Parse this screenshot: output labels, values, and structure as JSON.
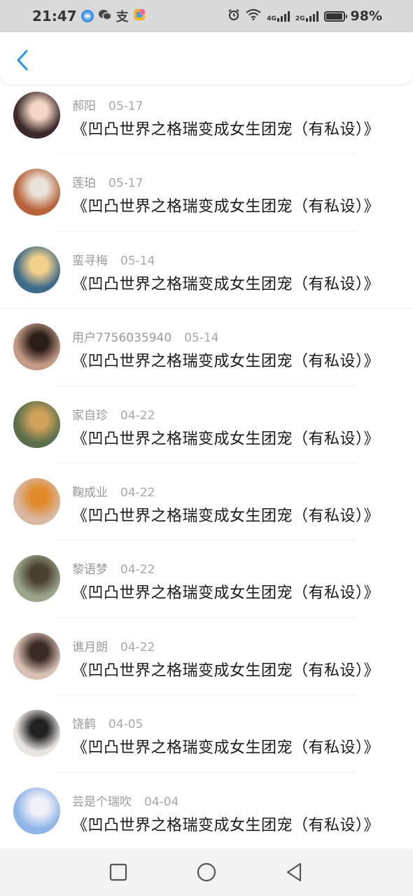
{
  "status_bar": {
    "time": "21:47",
    "apps": [
      {
        "icon": "browser-icon",
        "color": "#3a8fe0",
        "glyph": "●"
      },
      {
        "icon": "wechat-icon",
        "color": "#444444",
        "glyph": "◉"
      },
      {
        "icon": "alipay-icon",
        "color": "#444444",
        "glyph": "支"
      },
      {
        "icon": "app-store-icon",
        "color": "#f06aa0",
        "glyph": "■"
      }
    ],
    "network_4g": "4G",
    "network_2g": "2G",
    "battery_level": 98,
    "battery_text": "98%"
  },
  "comments": [
    {
      "user": "郝阳",
      "date": "05-17",
      "title": "《凹凸世界之格瑞变成女生团宠（有私设）》",
      "avatar_color": "#3b2a2a",
      "avatar_accent": "#f2d5c4"
    },
    {
      "user": "莲珀",
      "date": "05-17",
      "title": "《凹凸世界之格瑞变成女生团宠（有私设）》",
      "avatar_color": "#b8643a",
      "avatar_accent": "#e9e2d8"
    },
    {
      "user": "蛮寻梅",
      "date": "05-14",
      "title": "《凹凸世界之格瑞变成女生团宠（有私设）》",
      "avatar_color": "#3d6b8a",
      "avatar_accent": "#f3d18a"
    },
    {
      "user": "用户7756035940",
      "date": "05-14",
      "title": "《凹凸世界之格瑞变成女生团宠（有私设）》",
      "avatar_color": "#c49a86",
      "avatar_accent": "#2b1d18"
    },
    {
      "user": "家自珍",
      "date": "04-22",
      "title": "《凹凸世界之格瑞变成女生团宠（有私设）》",
      "avatar_color": "#5b6f4a",
      "avatar_accent": "#cfa15b"
    },
    {
      "user": "鞠成业",
      "date": "04-22",
      "title": "《凹凸世界之格瑞变成女生团宠（有私设）》",
      "avatar_color": "#d8b8a2",
      "avatar_accent": "#e08a2c"
    },
    {
      "user": "黎语梦",
      "date": "04-22",
      "title": "《凹凸世界之格瑞变成女生团宠（有私设）》",
      "avatar_color": "#9aa58a",
      "avatar_accent": "#4a4030"
    },
    {
      "user": "谯月朗",
      "date": "04-22",
      "title": "《凹凸世界之格瑞变成女生团宠（有私设）》",
      "avatar_color": "#d9c0b4",
      "avatar_accent": "#3a2a24"
    },
    {
      "user": "饶鹤",
      "date": "04-05",
      "title": "《凹凸世界之格瑞变成女生团宠（有私设）》",
      "avatar_color": "#e8e4e0",
      "avatar_accent": "#222222"
    },
    {
      "user": "芸是个瑞吹",
      "date": "04-04",
      "title": "《凹凸世界之格瑞变成女生团宠（有私设）》",
      "avatar_color": "#8fb5e6",
      "avatar_accent": "#f1f1f8"
    }
  ],
  "colors": {
    "accent": "#2196f3",
    "username": "#9a9a9a",
    "title": "#1a1a1a"
  }
}
